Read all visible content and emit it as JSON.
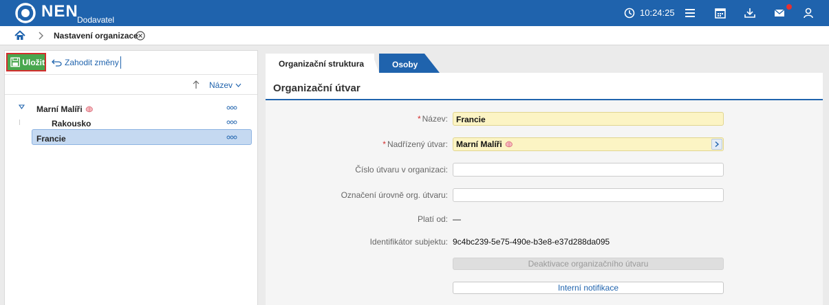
{
  "header": {
    "brand": "NEN",
    "brand_sub": "Dodavatel",
    "clock": "10:24:25",
    "accent_color": "#1f63ad",
    "icons": [
      "clock-icon",
      "menu-icon",
      "calendar-icon",
      "download-icon",
      "mail-icon",
      "user-icon"
    ]
  },
  "breadcrumb": {
    "current": "Nastavení organizace"
  },
  "toolbar": {
    "save_label": "Uložit",
    "discard_label": "Zahodit změny"
  },
  "tree": {
    "sort_label": "Název",
    "items": [
      {
        "label": "Marní Malíři",
        "level": 0,
        "expanded": true
      },
      {
        "label": "Rakousko",
        "level": 1
      },
      {
        "label": "Francie",
        "level": 1,
        "selected": true
      }
    ]
  },
  "tabs": [
    {
      "label": "Organizační struktura",
      "active": true
    },
    {
      "label": "Osoby",
      "active": false
    }
  ],
  "form": {
    "title": "Organizační útvar",
    "name_label": "Název:",
    "name_value": "Francie",
    "parent_label": "Nadřízený útvar:",
    "parent_value": "Marní Malíři",
    "number_label": "Číslo útvaru v organizaci:",
    "number_value": "",
    "level_label": "Označení úrovně org. útvaru:",
    "level_value": "",
    "valid_label": "Platí od:",
    "valid_value": "—",
    "subject_label": "Identifikátor subjektu:",
    "subject_value": "9c4bc239-5e75-490e-b3e8-e37d288da095",
    "deactivate_label": "Deaktivace organizačního útvaru",
    "notify_label": "Interní notifikace"
  }
}
